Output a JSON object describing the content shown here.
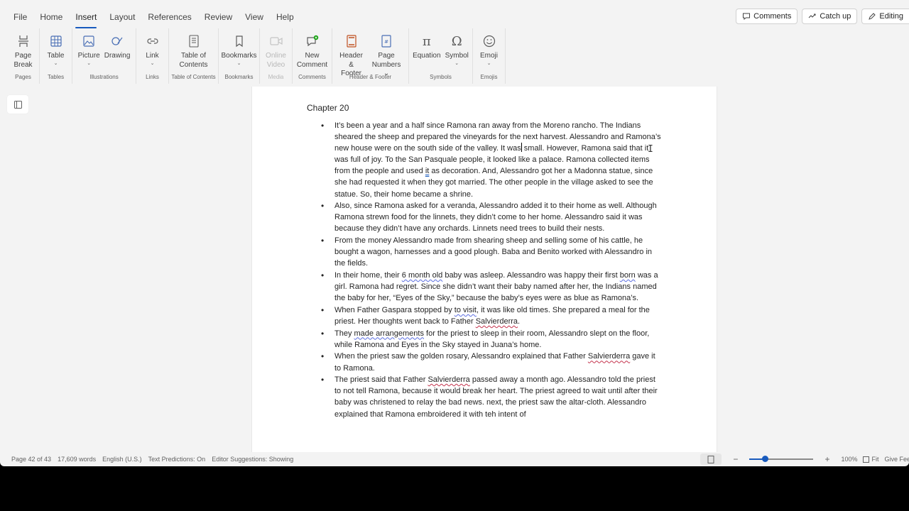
{
  "menu": {
    "tabs": [
      {
        "label": "File"
      },
      {
        "label": "Home"
      },
      {
        "label": "Insert"
      },
      {
        "label": "Layout"
      },
      {
        "label": "References"
      },
      {
        "label": "Review"
      },
      {
        "label": "View"
      },
      {
        "label": "Help"
      }
    ],
    "active_tab": "Insert",
    "comments_label": "Comments",
    "catchup_label": "Catch up",
    "editing_label": "Editing"
  },
  "ribbon": {
    "pages": {
      "group": "Pages",
      "page_break": "Page\nBreak"
    },
    "tables": {
      "group": "Tables",
      "table": "Table"
    },
    "illustrations": {
      "group": "Illustrations",
      "picture": "Picture",
      "drawing": "Drawing"
    },
    "links": {
      "group": "Links",
      "link": "Link"
    },
    "toc": {
      "group": "Table of Contents",
      "toc": "Table of\nContents"
    },
    "bookmarks": {
      "group": "Bookmarks",
      "bookmarks": "Bookmarks"
    },
    "media": {
      "group": "Media",
      "online_video": "Online\nVideo"
    },
    "comments": {
      "group": "Comments",
      "new_comment": "New\nComment"
    },
    "header_footer": {
      "group": "Header & Footer",
      "header_footer": "Header &\nFooter",
      "page_numbers": "Page\nNumbers"
    },
    "symbols": {
      "group": "Symbols",
      "equation": "Equation",
      "symbol": "Symbol"
    },
    "emojis": {
      "group": "Emojis",
      "emoji": "Emoji"
    }
  },
  "document": {
    "chapter": "Chapter 20",
    "p1": "It’s been a year and a half since Ramona ran away from the Moreno rancho. The Indians sheared the sheep and prepared the vineyards for the next harvest. Alessandro and Ramona’s new house were on the south side of the valley. It was",
    "p1b": " small. However, Ramona said that it was full of joy. To the San Pasquale people, it looked like a palace. Ramona collected items from the people and used ",
    "p1_it": "it",
    "p1c": " as decoration. And, Alessandro got her a Madonna statue, since she had requested it when they got married. The other people in the village asked to see the statue. So, their home became a shrine.",
    "p2": "Also, since Ramona asked for a veranda, Alessandro added it to their home as well. Although Ramona strewn food for the linnets, they didn’t come to her home. Alessandro said it was because they didn’t have any orchards. Linnets need trees to build their nests.",
    "p3": "From the money Alessandro made from shearing sheep and selling some of his cattle, he bought a wagon, harnesses and a good plough. Baba and Benito worked with Alessandro in the fields.",
    "p4a": "In their home, their ",
    "p4_u": "6 month old",
    "p4b": " baby was asleep. Alessandro was happy their first ",
    "p4_born": "born",
    "p4c": " was a girl. Ramona had regret. Since she didn’t want their baby named after her, the Indians named the baby for her, “Eyes of the Sky,” because the baby’s eyes were as blue as Ramona’s.",
    "p5a": "When Father Gaspara stopped by ",
    "p5_u": "to visit",
    "p5b": ", it was like old times. She prepared a meal for the priest. Her thoughts went back to Father ",
    "p5_s": "Salvierderra",
    "p5c": ".",
    "p6a": "They ",
    "p6_u": "made arrangements",
    "p6b": " for the priest to sleep in their room, Alessandro slept on the floor, while Ramona and Eyes in the Sky stayed in Juana’s home.",
    "p7a": "When the priest saw the golden rosary, Alessandro explained that Father ",
    "p7_s": "Salvierderra",
    "p7b": " gave it to Ramona.",
    "p8a": "The priest said that Father ",
    "p8_s": "Salvierderra",
    "p8b": " passed away a month ago. Alessandro told the priest to not tell Ramona, because it would break her heart. The priest agreed to wait until after their baby was christened to relay the bad news.  next, the priest saw the altar-cloth. Alessandro explained that Ramona embroidered it with teh intent of"
  },
  "status": {
    "page": "Page 42 of 43",
    "words": "17,609 words",
    "language": "English (U.S.)",
    "predictions": "Text Predictions: On",
    "editor": "Editor Suggestions: Showing",
    "zoom": "100%",
    "fit": "Fit",
    "feedback": "Give Fee",
    "zoom_level": 0.25
  }
}
